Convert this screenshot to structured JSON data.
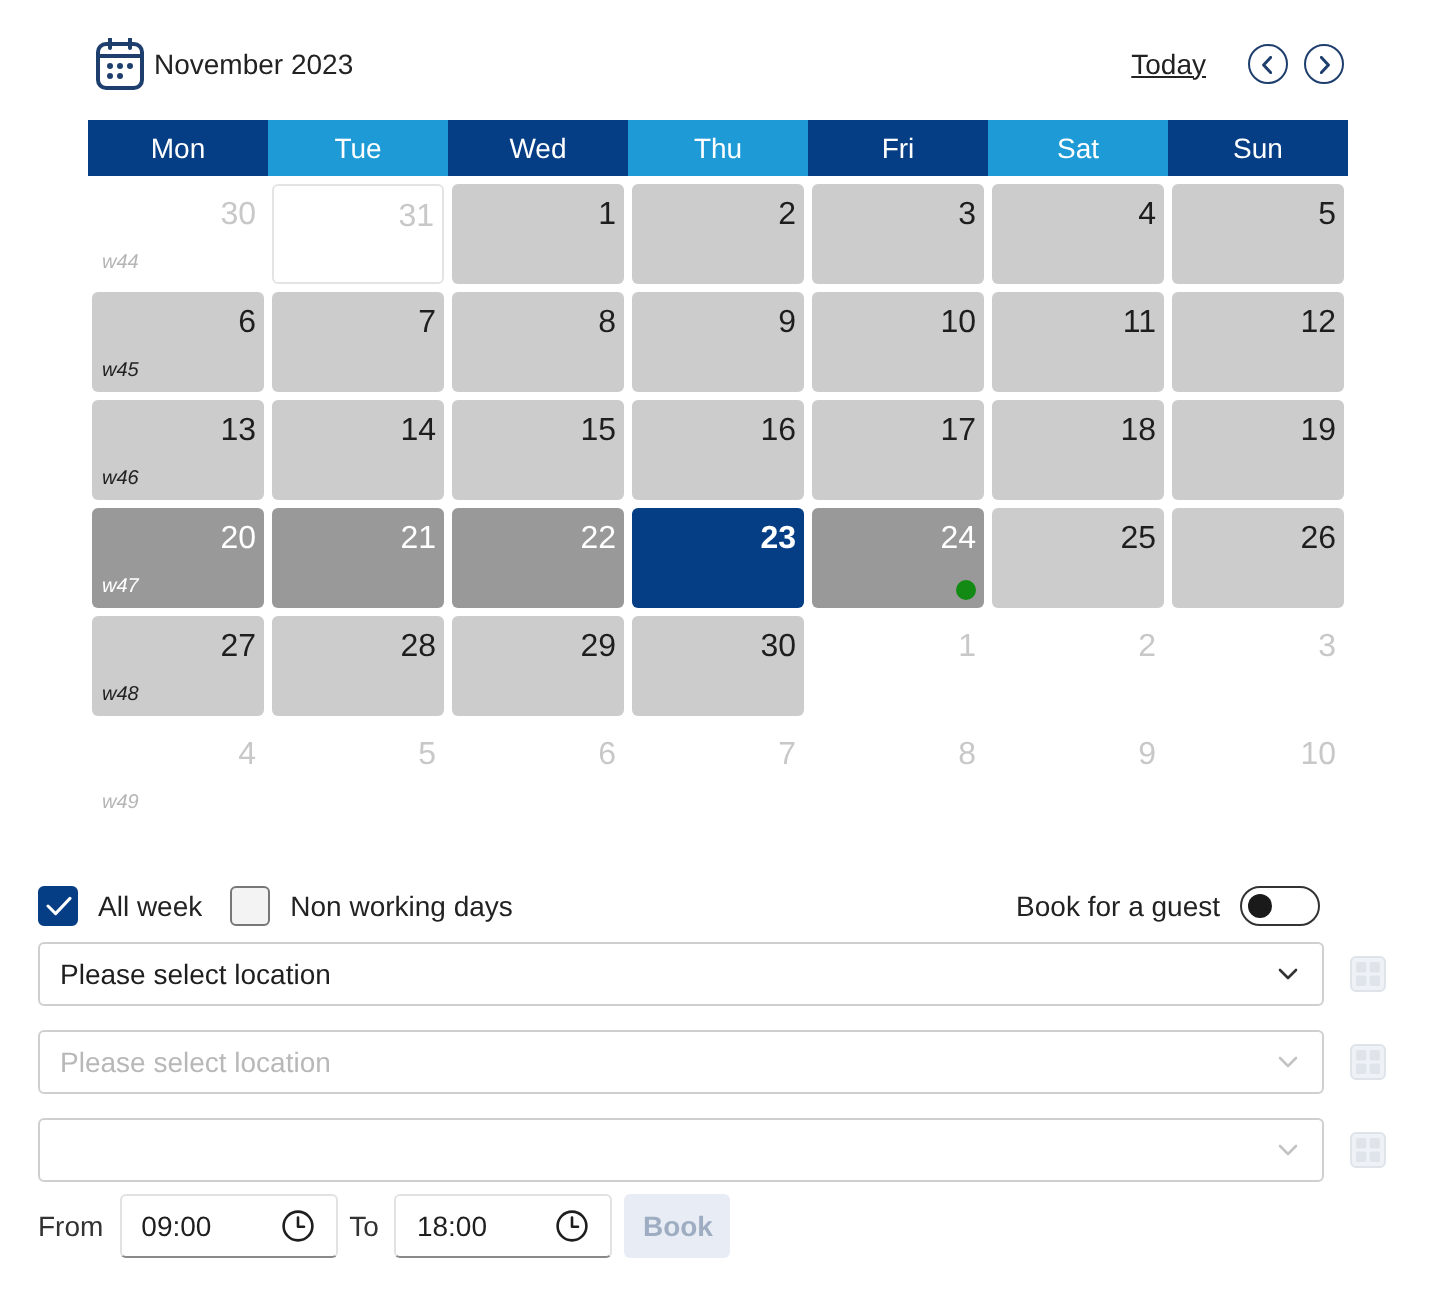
{
  "header": {
    "title": "November 2023",
    "today_link": "Today"
  },
  "weekdays": [
    "Mon",
    "Tue",
    "Wed",
    "Thu",
    "Fri",
    "Sat",
    "Sun"
  ],
  "weeks": [
    {
      "label": "w44",
      "days": [
        {
          "day": "30",
          "kind": "outside",
          "dot": false
        },
        {
          "day": "31",
          "kind": "outlined",
          "dot": false
        },
        {
          "day": "1",
          "kind": "free",
          "dot": false
        },
        {
          "day": "2",
          "kind": "free",
          "dot": false
        },
        {
          "day": "3",
          "kind": "free",
          "dot": false
        },
        {
          "day": "4",
          "kind": "free",
          "dot": false
        },
        {
          "day": "5",
          "kind": "free",
          "dot": false
        }
      ]
    },
    {
      "label": "w45",
      "days": [
        {
          "day": "6",
          "kind": "free",
          "dot": false
        },
        {
          "day": "7",
          "kind": "free",
          "dot": false
        },
        {
          "day": "8",
          "kind": "free",
          "dot": false
        },
        {
          "day": "9",
          "kind": "free",
          "dot": false
        },
        {
          "day": "10",
          "kind": "free",
          "dot": false
        },
        {
          "day": "11",
          "kind": "free",
          "dot": false
        },
        {
          "day": "12",
          "kind": "free",
          "dot": false
        }
      ]
    },
    {
      "label": "w46",
      "days": [
        {
          "day": "13",
          "kind": "free",
          "dot": false
        },
        {
          "day": "14",
          "kind": "free",
          "dot": false
        },
        {
          "day": "15",
          "kind": "free",
          "dot": false
        },
        {
          "day": "16",
          "kind": "free",
          "dot": false
        },
        {
          "day": "17",
          "kind": "free",
          "dot": false
        },
        {
          "day": "18",
          "kind": "free",
          "dot": false
        },
        {
          "day": "19",
          "kind": "free",
          "dot": false
        }
      ]
    },
    {
      "label": "w47",
      "days": [
        {
          "day": "20",
          "kind": "busy",
          "dot": false
        },
        {
          "day": "21",
          "kind": "busy",
          "dot": false
        },
        {
          "day": "22",
          "kind": "busy",
          "dot": false
        },
        {
          "day": "23",
          "kind": "today",
          "dot": false
        },
        {
          "day": "24",
          "kind": "busy",
          "dot": true
        },
        {
          "day": "25",
          "kind": "free",
          "dot": false
        },
        {
          "day": "26",
          "kind": "free",
          "dot": false
        }
      ]
    },
    {
      "label": "w48",
      "days": [
        {
          "day": "27",
          "kind": "free",
          "dot": false
        },
        {
          "day": "28",
          "kind": "free",
          "dot": false
        },
        {
          "day": "29",
          "kind": "free",
          "dot": false
        },
        {
          "day": "30",
          "kind": "free",
          "dot": false
        },
        {
          "day": "1",
          "kind": "outside",
          "dot": false
        },
        {
          "day": "2",
          "kind": "outside",
          "dot": false
        },
        {
          "day": "3",
          "kind": "outside",
          "dot": false
        }
      ]
    },
    {
      "label": "w49",
      "days": [
        {
          "day": "4",
          "kind": "outside",
          "dot": false
        },
        {
          "day": "5",
          "kind": "outside",
          "dot": false
        },
        {
          "day": "6",
          "kind": "outside",
          "dot": false
        },
        {
          "day": "7",
          "kind": "outside",
          "dot": false
        },
        {
          "day": "8",
          "kind": "outside",
          "dot": false
        },
        {
          "day": "9",
          "kind": "outside",
          "dot": false
        },
        {
          "day": "10",
          "kind": "outside",
          "dot": false
        }
      ]
    }
  ],
  "checkboxes": [
    {
      "label": "All week",
      "checked": true
    },
    {
      "label": "Non working days",
      "checked": false
    }
  ],
  "guest_toggle": {
    "label": "Book for a guest",
    "on": false
  },
  "selects": [
    {
      "value": "Please select location",
      "disabled": false
    },
    {
      "placeholder": "Please select location",
      "disabled": true
    },
    {
      "disabled": true
    }
  ],
  "time_range": [
    {
      "label": "From",
      "value": "09:00"
    },
    {
      "label": "To",
      "value": "18:00"
    }
  ],
  "book_button": {
    "label": "Book",
    "disabled": true
  }
}
